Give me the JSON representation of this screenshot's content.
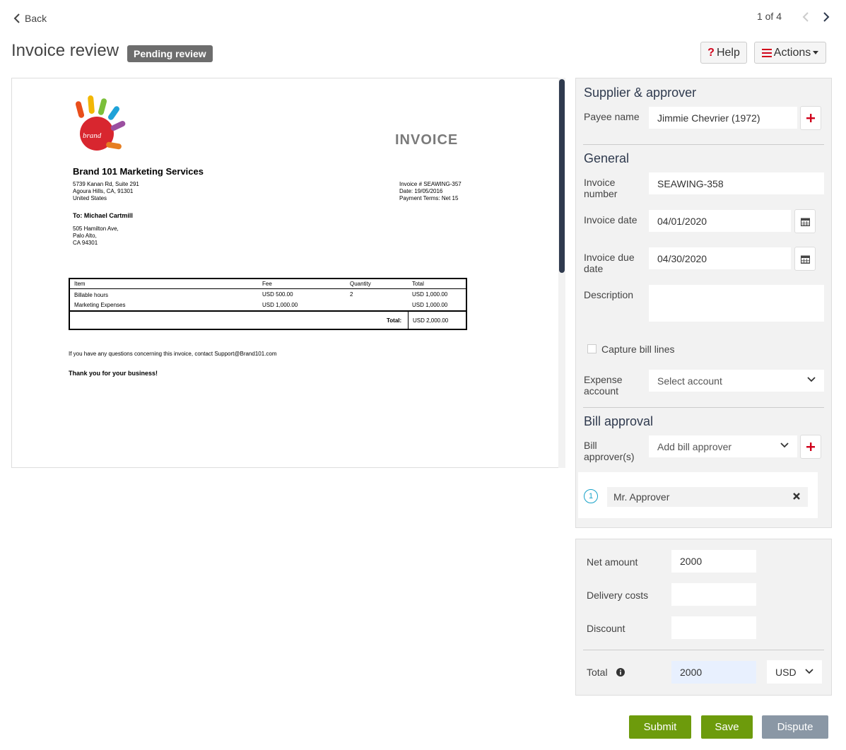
{
  "nav": {
    "back_label": "Back",
    "pager": "1 of 4"
  },
  "header": {
    "title": "Invoice review",
    "status": "Pending review",
    "help_label": "Help",
    "actions_label": "Actions"
  },
  "document": {
    "title": "INVOICE",
    "logo_text": "brand",
    "company": "Brand 101 Marketing Services",
    "company_address": [
      "5739 Kanan Rd, Suite 291",
      "Agoura Hills, CA, 91301",
      "United States"
    ],
    "invoice_meta": [
      "Invoice # SEAWING-357",
      "Date: 19/05/2016",
      "Payment Terms: Net 15"
    ],
    "to_label": "To: Michael Cartmill",
    "to_address": [
      "505 Hamilton Ave,",
      "Palo Alto,",
      "CA 94301"
    ],
    "table": {
      "headers": [
        "Item",
        "Fee",
        "Quantity",
        "Total"
      ],
      "rows": [
        [
          "Billable hours",
          "USD 500.00",
          "2",
          "USD 1,000.00"
        ],
        [
          "Marketing Expenses",
          "USD 1,000.00",
          "",
          "USD 1,000.00"
        ]
      ],
      "total_label": "Total:",
      "total_value": "USD 2,000.00"
    },
    "contact": "If you have any questions concerning this invoice, contact  Support@Brand101.com",
    "thanks": "Thank you for your business!"
  },
  "supplier": {
    "section_title": "Supplier & approver",
    "payee_label": "Payee name",
    "payee_value": "Jimmie Chevrier (1972)"
  },
  "general": {
    "section_title": "General",
    "invoice_number_label": "Invoice number",
    "invoice_number_value": "SEAWING-358",
    "invoice_date_label": "Invoice date",
    "invoice_date_value": "04/01/2020",
    "due_date_label": "Invoice due date",
    "due_date_value": "04/30/2020",
    "description_label": "Description",
    "description_value": "",
    "capture_lines_label": "Capture bill lines",
    "expense_label": "Expense account",
    "expense_placeholder": "Select account"
  },
  "approval": {
    "section_title": "Bill approval",
    "approvers_label": "Bill approver(s)",
    "approver_placeholder": "Add bill approver",
    "approvers": [
      {
        "index": "1",
        "name": "Mr. Approver"
      }
    ]
  },
  "totals": {
    "net_label": "Net amount",
    "net_value": "2000",
    "delivery_label": "Delivery costs",
    "delivery_value": "",
    "discount_label": "Discount",
    "discount_value": "",
    "total_label": "Total",
    "total_value": "2000",
    "currency": "USD"
  },
  "footer": {
    "submit": "Submit",
    "save": "Save",
    "dispute": "Dispute"
  },
  "colors": {
    "accent_green": "#6d9b0c",
    "dispute_gray": "#8a97a5",
    "badge_gray": "#6d6d6d",
    "plus_red": "#d0021b",
    "section_navy": "#2f3a4e"
  }
}
